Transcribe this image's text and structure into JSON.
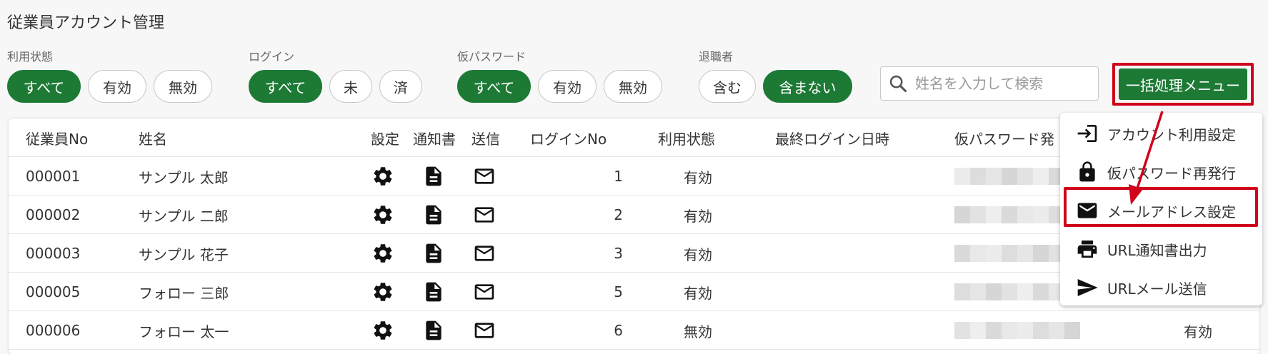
{
  "page_title": "従業員アカウント管理",
  "filters": {
    "status": {
      "label": "利用状態",
      "options": [
        "すべて",
        "有効",
        "無効"
      ],
      "selected": 0
    },
    "login": {
      "label": "ログイン",
      "options": [
        "すべて",
        "未",
        "済"
      ],
      "selected": 0
    },
    "temp_password": {
      "label": "仮パスワード",
      "options": [
        "すべて",
        "有効",
        "無効"
      ],
      "selected": 0
    },
    "retired": {
      "label": "退職者",
      "options": [
        "含む",
        "含まない"
      ],
      "selected": 1
    }
  },
  "search": {
    "placeholder": "姓名を入力して検索",
    "value": ""
  },
  "bulk_menu": {
    "button_label": "一括処理メニュー",
    "items": [
      {
        "label": "アカウント利用設定",
        "icon": "login-icon"
      },
      {
        "label": "仮パスワード再発行",
        "icon": "lock-icon"
      },
      {
        "label": "メールアドレス設定",
        "icon": "mail-icon"
      },
      {
        "label": "URL通知書出力",
        "icon": "printer-icon"
      },
      {
        "label": "URLメール送信",
        "icon": "send-icon"
      }
    ],
    "highlighted_index": 2
  },
  "table": {
    "headers": {
      "employee_no": "従業員No",
      "name": "姓名",
      "settings": "設定",
      "notice": "通知書",
      "send": "送信",
      "login_no": "ログインNo",
      "status": "利用状態",
      "last_login": "最終ログイン日時",
      "temp_password": "仮パスワード発"
    },
    "rows": [
      {
        "employee_no": "000001",
        "name": "サンプル 太郎",
        "login_no": "1",
        "status": "有効",
        "last_login": ""
      },
      {
        "employee_no": "000002",
        "name": "サンプル 二郎",
        "login_no": "2",
        "status": "有効",
        "last_login": ""
      },
      {
        "employee_no": "000003",
        "name": "サンプル 花子",
        "login_no": "3",
        "status": "有効",
        "last_login": ""
      },
      {
        "employee_no": "000005",
        "name": "フォロー 三郎",
        "login_no": "5",
        "status": "有効",
        "last_login": ""
      },
      {
        "employee_no": "000006",
        "name": "フォロー 太一",
        "login_no": "6",
        "status": "無効",
        "last_login": "",
        "temp_password_status": "有効"
      }
    ]
  },
  "colors": {
    "accent": "#1d7a35",
    "highlight": "#d0021b"
  }
}
